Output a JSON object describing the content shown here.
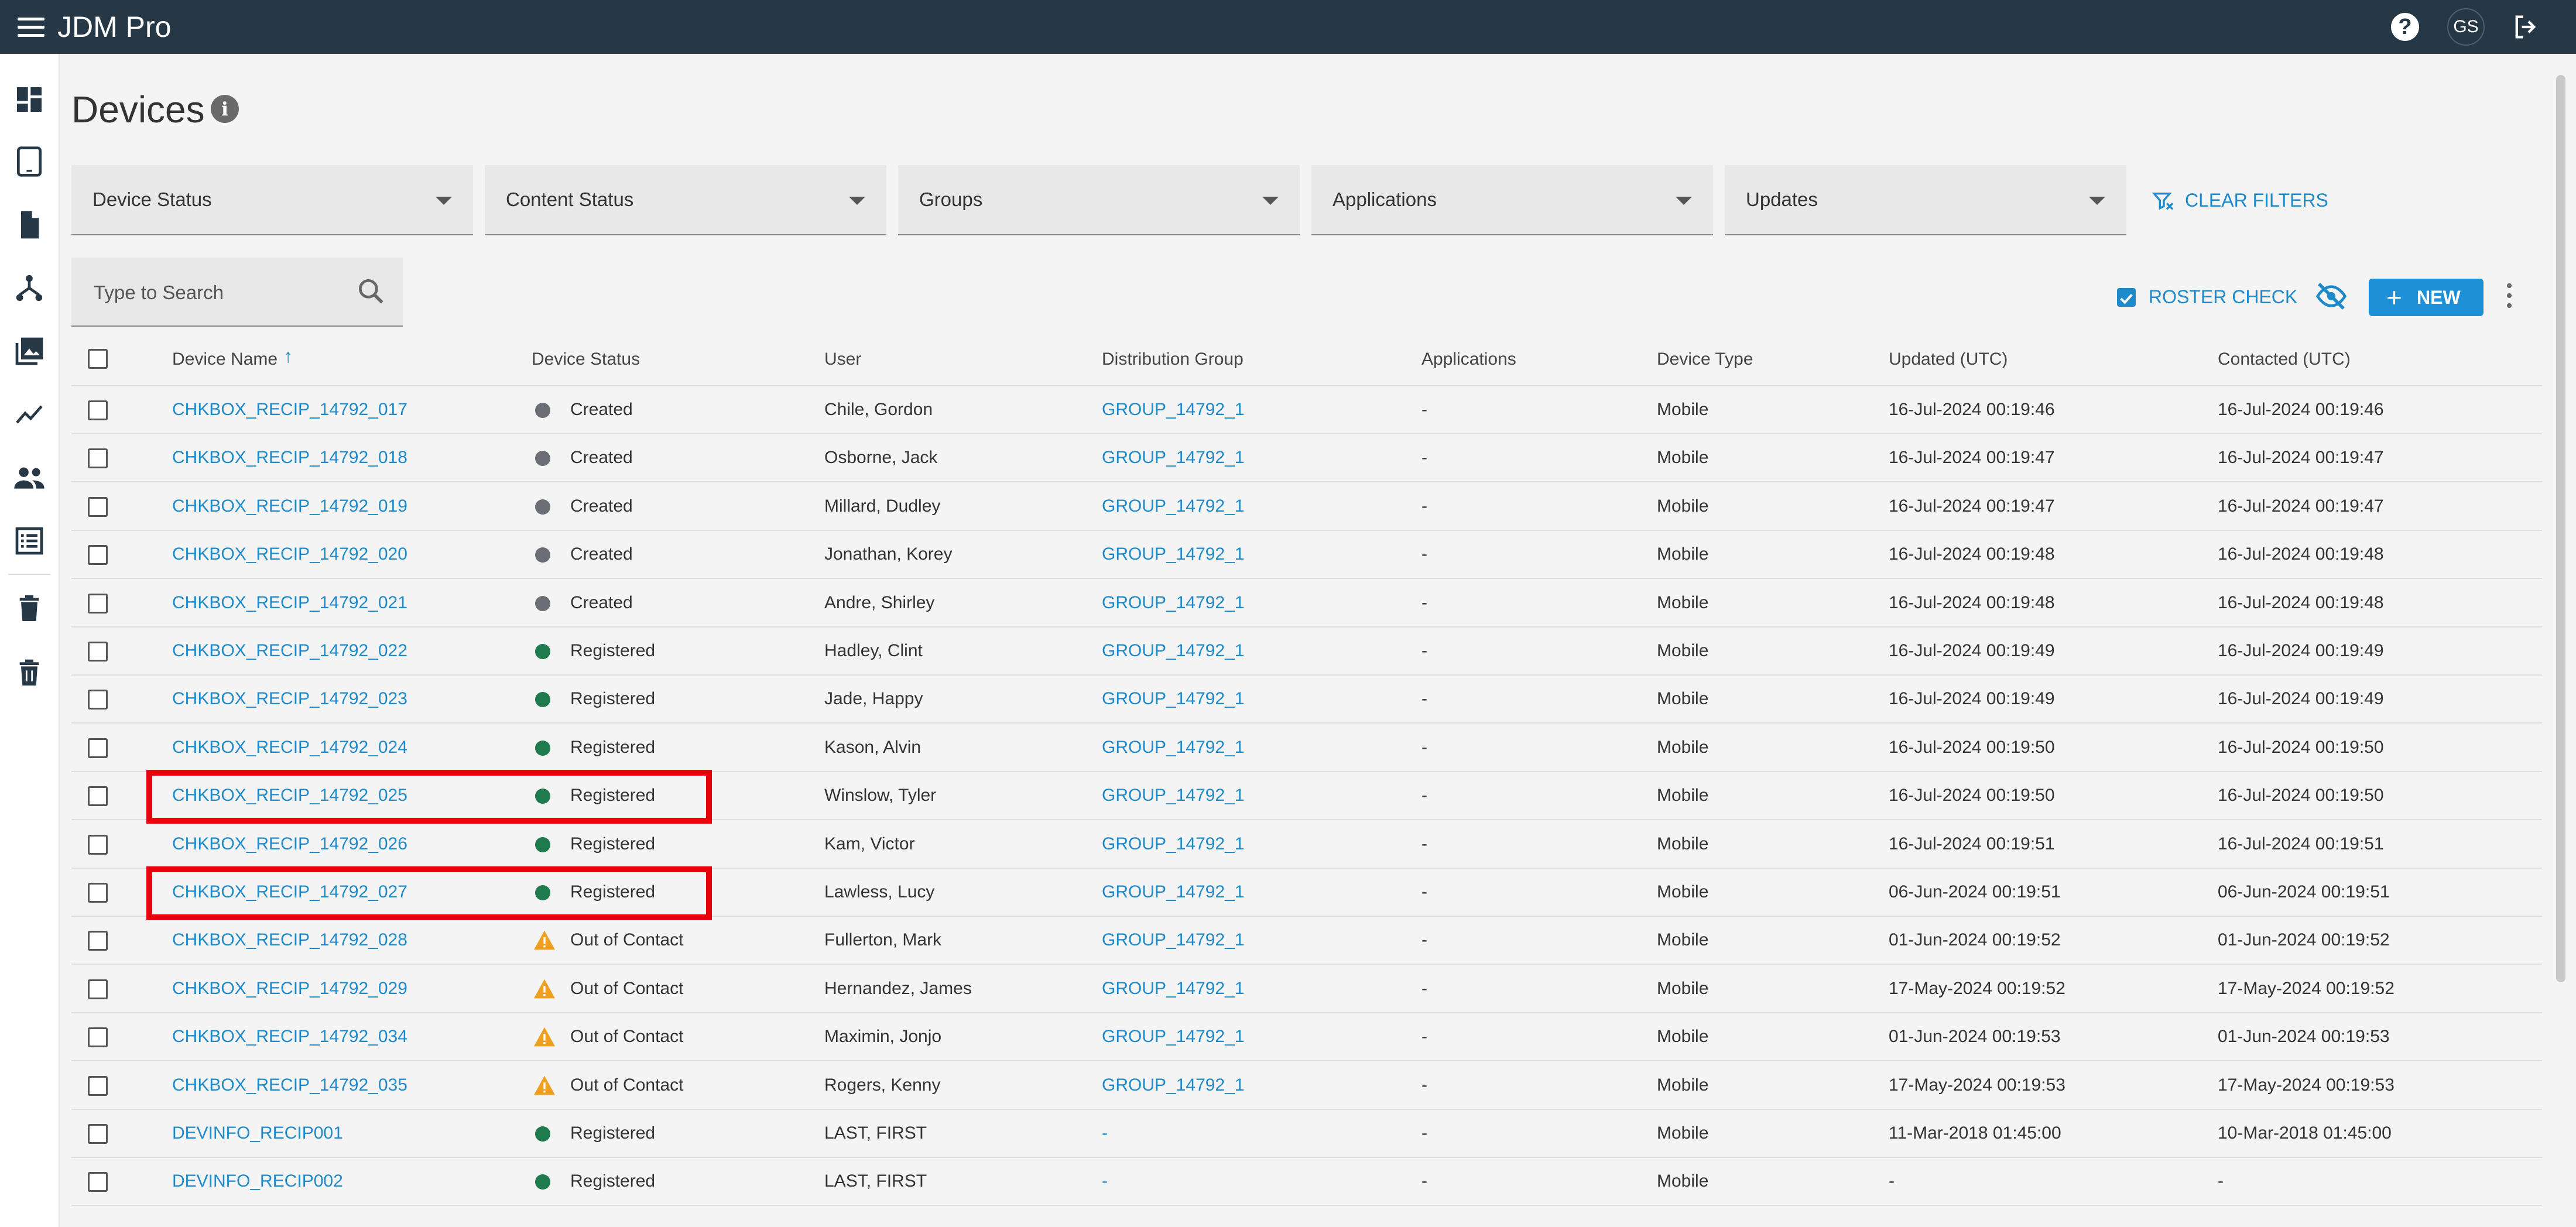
{
  "app": {
    "title": "JDM Pro",
    "user_initials": "GS"
  },
  "page": {
    "title": "Devices"
  },
  "filters": [
    {
      "label": "Device Status"
    },
    {
      "label": "Content Status"
    },
    {
      "label": "Groups"
    },
    {
      "label": "Applications"
    },
    {
      "label": "Updates"
    }
  ],
  "clear_filters_label": "CLEAR FILTERS",
  "search": {
    "placeholder": "Type to Search"
  },
  "toolbar": {
    "roster_check_label": "ROSTER CHECK",
    "new_label": "NEW"
  },
  "table": {
    "columns": [
      "Device Name",
      "Device Status",
      "User",
      "Distribution Group",
      "Applications",
      "Device Type",
      "Updated (UTC)",
      "Contacted (UTC)"
    ],
    "sort_column": "Device Name",
    "rows": [
      {
        "name": "CHKBOX_RECIP_14792_017",
        "status": "Created",
        "user": "Chile, Gordon",
        "group": "GROUP_14792_1",
        "apps": "-",
        "type": "Mobile",
        "updated": "16-Jul-2024 00:19:46",
        "contacted": "16-Jul-2024 00:19:46"
      },
      {
        "name": "CHKBOX_RECIP_14792_018",
        "status": "Created",
        "user": "Osborne, Jack",
        "group": "GROUP_14792_1",
        "apps": "-",
        "type": "Mobile",
        "updated": "16-Jul-2024 00:19:47",
        "contacted": "16-Jul-2024 00:19:47"
      },
      {
        "name": "CHKBOX_RECIP_14792_019",
        "status": "Created",
        "user": "Millard, Dudley",
        "group": "GROUP_14792_1",
        "apps": "-",
        "type": "Mobile",
        "updated": "16-Jul-2024 00:19:47",
        "contacted": "16-Jul-2024 00:19:47"
      },
      {
        "name": "CHKBOX_RECIP_14792_020",
        "status": "Created",
        "user": "Jonathan, Korey",
        "group": "GROUP_14792_1",
        "apps": "-",
        "type": "Mobile",
        "updated": "16-Jul-2024 00:19:48",
        "contacted": "16-Jul-2024 00:19:48"
      },
      {
        "name": "CHKBOX_RECIP_14792_021",
        "status": "Created",
        "user": "Andre, Shirley",
        "group": "GROUP_14792_1",
        "apps": "-",
        "type": "Mobile",
        "updated": "16-Jul-2024 00:19:48",
        "contacted": "16-Jul-2024 00:19:48"
      },
      {
        "name": "CHKBOX_RECIP_14792_022",
        "status": "Registered",
        "user": "Hadley, Clint",
        "group": "GROUP_14792_1",
        "apps": "-",
        "type": "Mobile",
        "updated": "16-Jul-2024 00:19:49",
        "contacted": "16-Jul-2024 00:19:49"
      },
      {
        "name": "CHKBOX_RECIP_14792_023",
        "status": "Registered",
        "user": "Jade, Happy",
        "group": "GROUP_14792_1",
        "apps": "-",
        "type": "Mobile",
        "updated": "16-Jul-2024 00:19:49",
        "contacted": "16-Jul-2024 00:19:49"
      },
      {
        "name": "CHKBOX_RECIP_14792_024",
        "status": "Registered",
        "user": "Kason, Alvin",
        "group": "GROUP_14792_1",
        "apps": "-",
        "type": "Mobile",
        "updated": "16-Jul-2024 00:19:50",
        "contacted": "16-Jul-2024 00:19:50"
      },
      {
        "name": "CHKBOX_RECIP_14792_025",
        "status": "Registered",
        "user": "Winslow, Tyler",
        "group": "GROUP_14792_1",
        "apps": "-",
        "type": "Mobile",
        "updated": "16-Jul-2024 00:19:50",
        "contacted": "16-Jul-2024 00:19:50",
        "highlighted": true
      },
      {
        "name": "CHKBOX_RECIP_14792_026",
        "status": "Registered",
        "user": "Kam, Victor",
        "group": "GROUP_14792_1",
        "apps": "-",
        "type": "Mobile",
        "updated": "16-Jul-2024 00:19:51",
        "contacted": "16-Jul-2024 00:19:51"
      },
      {
        "name": "CHKBOX_RECIP_14792_027",
        "status": "Registered",
        "user": "Lawless, Lucy",
        "group": "GROUP_14792_1",
        "apps": "-",
        "type": "Mobile",
        "updated": "06-Jun-2024 00:19:51",
        "contacted": "06-Jun-2024 00:19:51",
        "highlighted": true
      },
      {
        "name": "CHKBOX_RECIP_14792_028",
        "status": "Out of Contact",
        "user": "Fullerton, Mark",
        "group": "GROUP_14792_1",
        "apps": "-",
        "type": "Mobile",
        "updated": "01-Jun-2024 00:19:52",
        "contacted": "01-Jun-2024 00:19:52"
      },
      {
        "name": "CHKBOX_RECIP_14792_029",
        "status": "Out of Contact",
        "user": "Hernandez, James",
        "group": "GROUP_14792_1",
        "apps": "-",
        "type": "Mobile",
        "updated": "17-May-2024 00:19:52",
        "contacted": "17-May-2024 00:19:52"
      },
      {
        "name": "CHKBOX_RECIP_14792_034",
        "status": "Out of Contact",
        "user": "Maximin, Jonjo",
        "group": "GROUP_14792_1",
        "apps": "-",
        "type": "Mobile",
        "updated": "01-Jun-2024 00:19:53",
        "contacted": "01-Jun-2024 00:19:53"
      },
      {
        "name": "CHKBOX_RECIP_14792_035",
        "status": "Out of Contact",
        "user": "Rogers, Kenny",
        "group": "GROUP_14792_1",
        "apps": "-",
        "type": "Mobile",
        "updated": "17-May-2024 00:19:53",
        "contacted": "17-May-2024 00:19:53"
      },
      {
        "name": "DEVINFO_RECIP001",
        "status": "Registered",
        "user": "LAST, FIRST",
        "group": "-",
        "apps": "-",
        "type": "Mobile",
        "updated": "11-Mar-2018 01:45:00",
        "contacted": "10-Mar-2018 01:45:00"
      },
      {
        "name": "DEVINFO_RECIP002",
        "status": "Registered",
        "user": "LAST, FIRST",
        "group": "-",
        "apps": "-",
        "type": "Mobile",
        "updated": "-",
        "contacted": "-"
      }
    ]
  },
  "status_colors": {
    "Created": "#6b6f75",
    "Registered": "#1f7a4d",
    "Out of Contact": "#f0a020"
  },
  "colors": {
    "topbar": "#263746",
    "link": "#1f8ac9",
    "primary_button": "#1e90d8",
    "highlight": "#e8000b"
  },
  "sidebar": {
    "icons": [
      "dashboard-icon",
      "tablet-icon",
      "document-icon",
      "hierarchy-icon",
      "photo-library-icon",
      "trend-chart-icon",
      "people-icon",
      "list-icon",
      "trash-icon",
      "trash-alt-icon"
    ]
  }
}
